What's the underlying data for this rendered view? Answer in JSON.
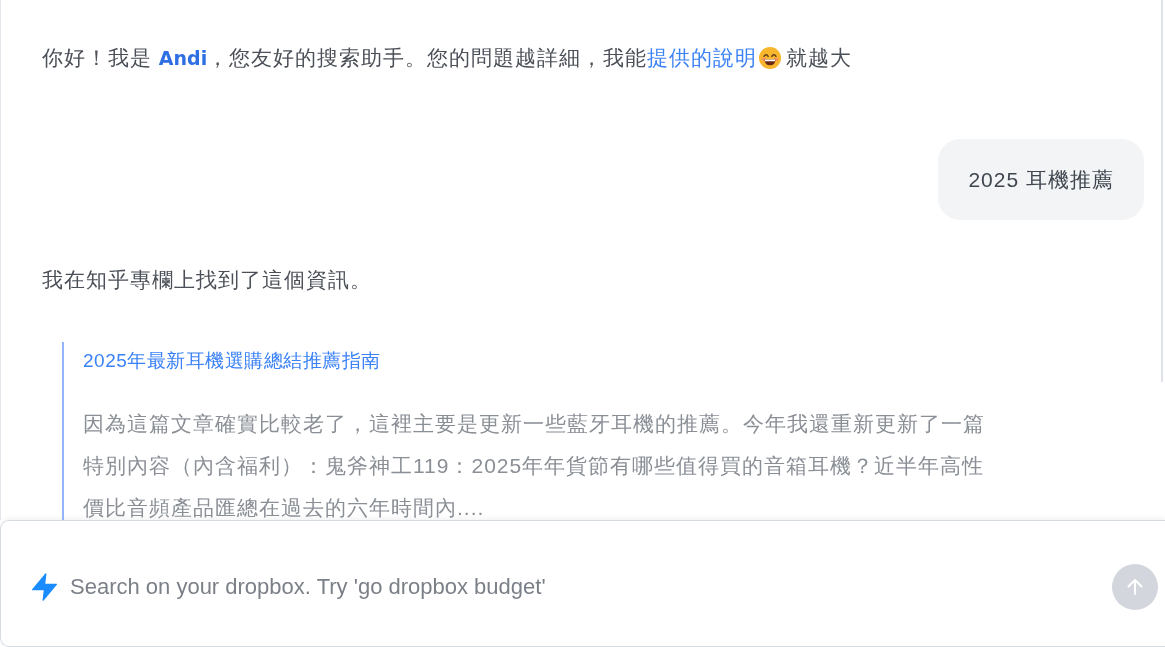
{
  "chat": {
    "messages": [
      {
        "kind": "greeting",
        "text": "你好！我是 **Andi**，您友好的搜索助手。您的問題越詳細，我能",
        "link": "提供的說明",
        "text_after": "就越大"
      },
      {
        "kind": "user",
        "text": "2025 耳機推薦"
      },
      {
        "kind": "assistant",
        "text": "我在知乎專欄上找到了這個資訊。",
        "quote": {
          "title": "2025年最新耳機選購總結推薦指南",
          "excerpt": "因為這篇文章確實比較老了，這裡主要是更新一些藍牙耳機的推薦。今年我還重新更新了一篇特別內容（內含福利）：鬼斧神工119：2025年年貨節有哪些值得買的音箱耳機？近半年高性價比音頻產品匯總在過去的六年時間內...."
        }
      }
    ]
  },
  "composer": {
    "placeholder": "Search on your dropbox. Try 'go dropbox budget'",
    "send_button": {
      "disabled": true
    }
  }
}
